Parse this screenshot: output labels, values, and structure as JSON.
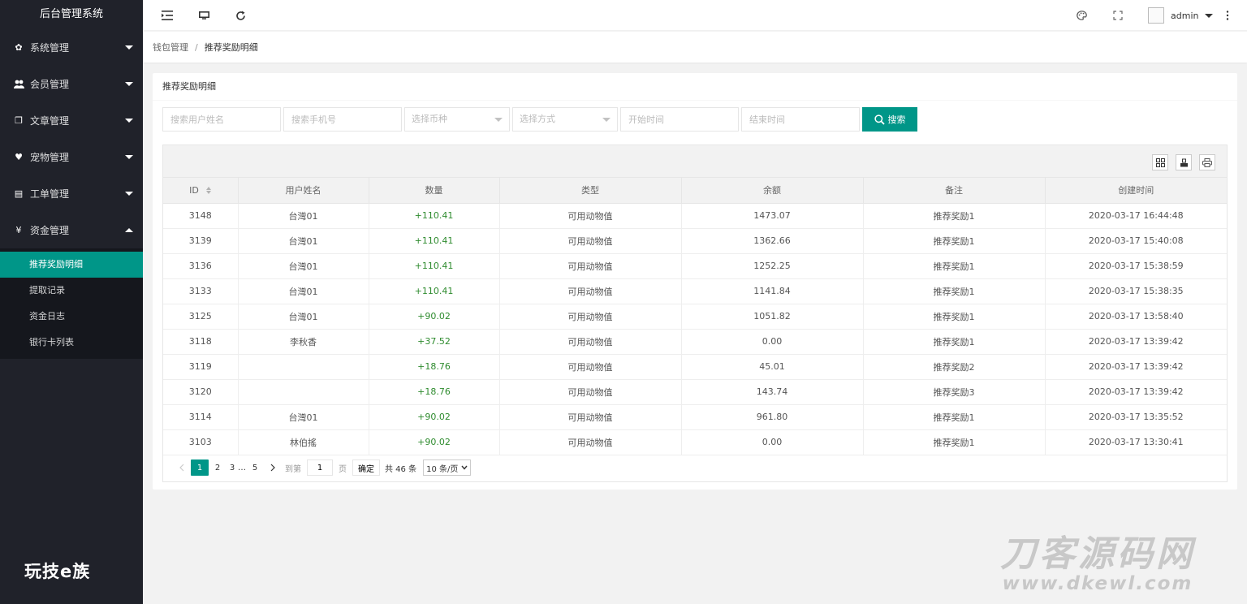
{
  "sidebar": {
    "brand": "后台管理系统",
    "items": [
      {
        "label": "系统管理",
        "icon": "gear-icon",
        "glyph": "✿"
      },
      {
        "label": "会员管理",
        "icon": "users-icon",
        "glyph": "👥"
      },
      {
        "label": "文章管理",
        "icon": "copy-icon",
        "glyph": "❐"
      },
      {
        "label": "宠物管理",
        "icon": "heart-icon",
        "glyph": "♥"
      },
      {
        "label": "工单管理",
        "icon": "file-icon",
        "glyph": "▤"
      },
      {
        "label": "资金管理",
        "icon": "yen-icon",
        "glyph": "¥"
      }
    ],
    "subitems": [
      "推荐奖励明细",
      "提取记录",
      "资金日志",
      "银行卡列表"
    ],
    "footer_logo": "玩技e族"
  },
  "header": {
    "user_name": "admin"
  },
  "breadcrumb": {
    "parent": "钱包管理",
    "separator": "/",
    "current": "推荐奖励明细"
  },
  "card": {
    "title": "推荐奖励明细"
  },
  "search": {
    "username_placeholder": "搜索用户姓名",
    "phone_placeholder": "搜索手机号",
    "currency_select": "选择币种",
    "method_select": "选择方式",
    "start_placeholder": "开始时间",
    "end_placeholder": "结束时间",
    "button_label": "搜索"
  },
  "table": {
    "headers": [
      "ID",
      "用户姓名",
      "数量",
      "类型",
      "余额",
      "备注",
      "创建时间"
    ],
    "rows": [
      {
        "id": "3148",
        "name": "台灣01",
        "qty": "+110.41",
        "type": "可用动物值",
        "balance": "1473.07",
        "note": "推荐奖励1",
        "time": "2020-03-17 16:44:48"
      },
      {
        "id": "3139",
        "name": "台灣01",
        "qty": "+110.41",
        "type": "可用动物值",
        "balance": "1362.66",
        "note": "推荐奖励1",
        "time": "2020-03-17 15:40:08"
      },
      {
        "id": "3136",
        "name": "台灣01",
        "qty": "+110.41",
        "type": "可用动物值",
        "balance": "1252.25",
        "note": "推荐奖励1",
        "time": "2020-03-17 15:38:59"
      },
      {
        "id": "3133",
        "name": "台灣01",
        "qty": "+110.41",
        "type": "可用动物值",
        "balance": "1141.84",
        "note": "推荐奖励1",
        "time": "2020-03-17 15:38:35"
      },
      {
        "id": "3125",
        "name": "台灣01",
        "qty": "+90.02",
        "type": "可用动物值",
        "balance": "1051.82",
        "note": "推荐奖励1",
        "time": "2020-03-17 13:58:40"
      },
      {
        "id": "3118",
        "name": "李秋香",
        "qty": "+37.52",
        "type": "可用动物值",
        "balance": "0.00",
        "note": "推荐奖励1",
        "time": "2020-03-17 13:39:42"
      },
      {
        "id": "3119",
        "name": "",
        "qty": "+18.76",
        "type": "可用动物值",
        "balance": "45.01",
        "note": "推荐奖励2",
        "time": "2020-03-17 13:39:42"
      },
      {
        "id": "3120",
        "name": "",
        "qty": "+18.76",
        "type": "可用动物值",
        "balance": "143.74",
        "note": "推荐奖励3",
        "time": "2020-03-17 13:39:42"
      },
      {
        "id": "3114",
        "name": "台灣01",
        "qty": "+90.02",
        "type": "可用动物值",
        "balance": "961.80",
        "note": "推荐奖励1",
        "time": "2020-03-17 13:35:52"
      },
      {
        "id": "3103",
        "name": "林伯搖",
        "qty": "+90.02",
        "type": "可用动物值",
        "balance": "0.00",
        "note": "推荐奖励1",
        "time": "2020-03-17 13:30:41"
      }
    ]
  },
  "pager": {
    "pages": [
      "1",
      "2",
      "3",
      "…",
      "5"
    ],
    "goto_label": "到第",
    "goto_value": "1",
    "page_unit": "页",
    "confirm": "确定",
    "total": "共 46 条",
    "page_size": "10 条/页"
  },
  "watermark": {
    "line1": "刀客源码网",
    "line2": "www.dkewl.com"
  },
  "colors": {
    "accent": "#009688",
    "sidebar_bg": "#20222a",
    "qty_positive": "#2e8b2e"
  }
}
